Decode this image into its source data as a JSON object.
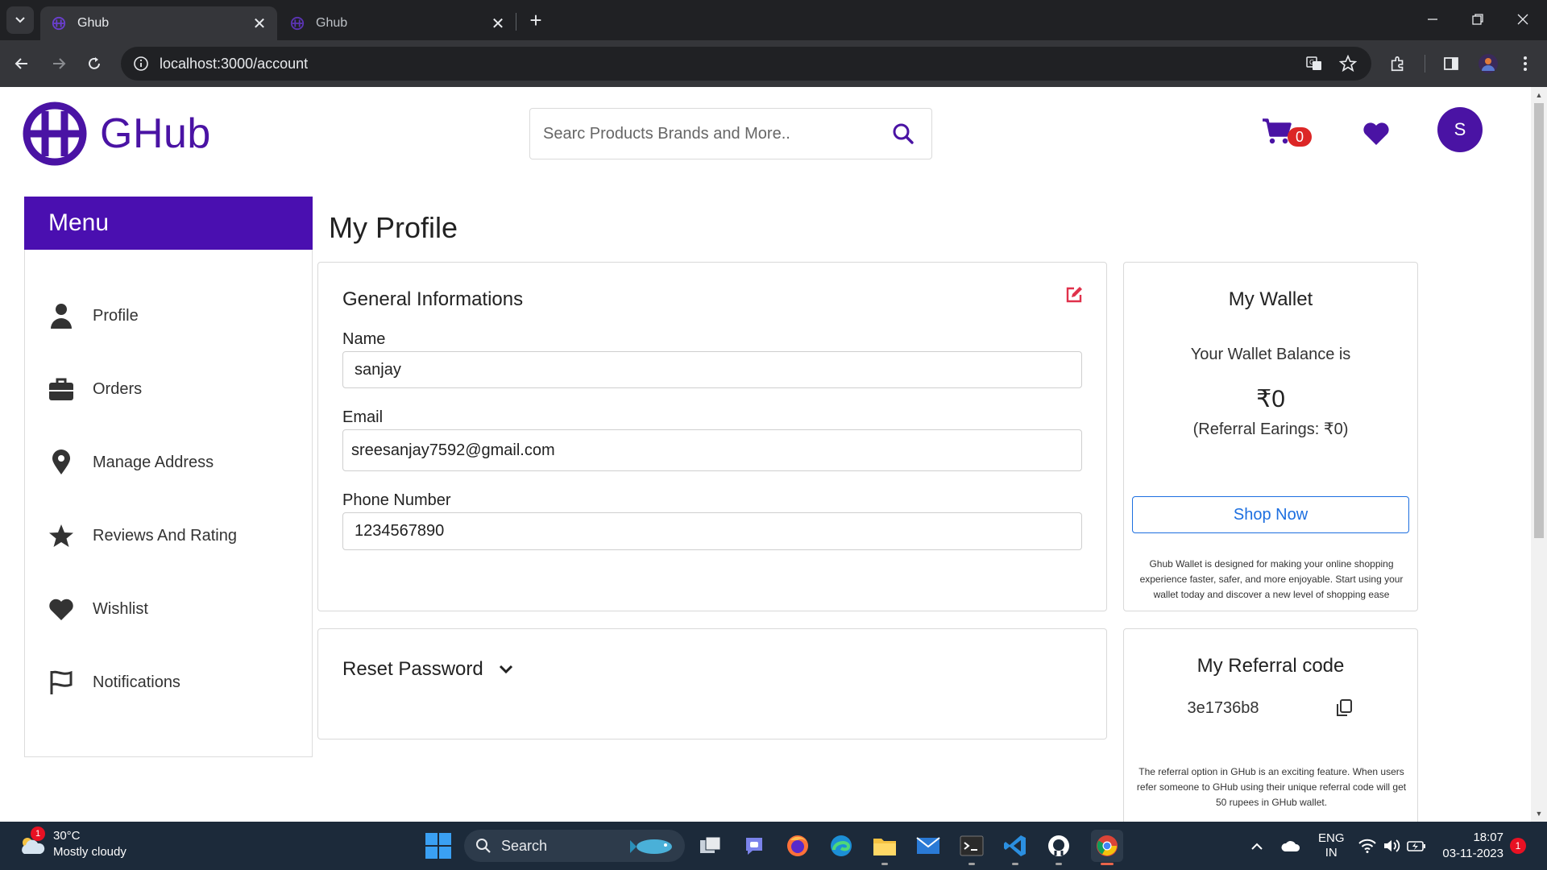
{
  "browser": {
    "tabs": [
      {
        "title": "Ghub",
        "active": true
      },
      {
        "title": "Ghub",
        "active": false
      }
    ],
    "url": "localhost:3000/account"
  },
  "header": {
    "logo_text": "GHub",
    "search_placeholder": "Searc Products Brands and More..",
    "cart_count": "0",
    "avatar_initial": "S"
  },
  "sidebar": {
    "title": "Menu",
    "items": [
      {
        "label": "Profile",
        "icon": "user-icon"
      },
      {
        "label": "Orders",
        "icon": "briefcase-icon"
      },
      {
        "label": "Manage Address",
        "icon": "map-pin-icon"
      },
      {
        "label": "Reviews And Rating",
        "icon": "star-icon"
      },
      {
        "label": "Wishlist",
        "icon": "heart-icon"
      },
      {
        "label": "Notifications",
        "icon": "flag-icon"
      }
    ]
  },
  "main": {
    "title": "My Profile",
    "general": {
      "title": "General Informations",
      "name_label": "Name",
      "name_value": "sanjay",
      "email_label": "Email",
      "email_value": "sreesanjay7592@gmail.com",
      "phone_label": "Phone Number",
      "phone_value": "1234567890"
    },
    "reset": {
      "title": "Reset Password"
    }
  },
  "wallet": {
    "title": "My Wallet",
    "balance_label": "Your Wallet Balance is",
    "balance": "₹0",
    "referral_earnings": "(Referral Earings: ₹0)",
    "shop_button": "Shop Now",
    "note": "Ghub Wallet is designed for making your online shopping experience faster, safer, and more enjoyable. Start using your wallet today and discover a new level of shopping ease"
  },
  "referral": {
    "title": "My Referral code",
    "code": "3e1736b8",
    "note": "The referral option in GHub is an exciting feature. When users refer someone to GHub using their unique referral code will get 50 rupees in GHub wallet."
  },
  "taskbar": {
    "weather_temp": "30°C",
    "weather_desc": "Mostly cloudy",
    "weather_badge": "1",
    "search_label": "Search",
    "lang_top": "ENG",
    "lang_bottom": "IN",
    "time": "18:07",
    "date": "03-11-2023",
    "notification_count": "1"
  },
  "colors": {
    "brand": "#4a13a4",
    "badge": "#dc2626",
    "link": "#1d6fe0"
  }
}
